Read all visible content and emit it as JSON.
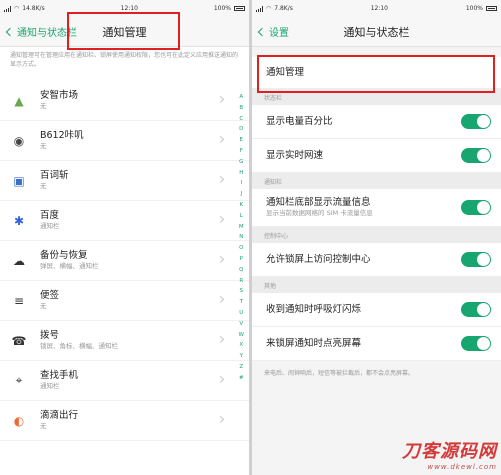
{
  "left": {
    "status": {
      "carrier": "14.8K/s",
      "time": "12:10",
      "battery": "100%"
    },
    "back_label": "通知与状态栏",
    "title": "通知管理",
    "description": "通知管理可在管理应用在通知栏、锁屏使用通知权限，您也可在此定义应用推送通知的显示方式。",
    "apps": [
      {
        "name": "安智市场",
        "sub": "无",
        "icon": "android-market-icon",
        "color": "#6aa84f"
      },
      {
        "name": "B612咔叽",
        "sub": "无",
        "icon": "camera-app-icon",
        "color": "#444444"
      },
      {
        "name": "百词斩",
        "sub": "无",
        "icon": "word-app-icon",
        "color": "#3b6ec5"
      },
      {
        "name": "百度",
        "sub": "通知栏",
        "icon": "baidu-paw-icon",
        "color": "#2f63d9"
      },
      {
        "name": "备份与恢复",
        "sub": "弹屏、横幅、通知栏",
        "icon": "backup-cloud-icon",
        "color": "#333333"
      },
      {
        "name": "便签",
        "sub": "无",
        "icon": "notes-icon",
        "color": "#333333"
      },
      {
        "name": "拨号",
        "sub": "锁屏、角标、横幅、通知栏",
        "icon": "phone-icon",
        "color": "#333333"
      },
      {
        "name": "查找手机",
        "sub": "通知栏",
        "icon": "find-phone-icon",
        "color": "#333333"
      },
      {
        "name": "滴滴出行",
        "sub": "无",
        "icon": "didi-icon",
        "color": "#f06a35"
      }
    ],
    "index_letters": [
      "A",
      "B",
      "C",
      "D",
      "E",
      "F",
      "G",
      "H",
      "I",
      "J",
      "K",
      "L",
      "M",
      "N",
      "O",
      "P",
      "Q",
      "R",
      "S",
      "T",
      "U",
      "V",
      "W",
      "X",
      "Y",
      "Z",
      "#"
    ]
  },
  "right": {
    "status": {
      "carrier": "7.8K/s",
      "time": "12:10",
      "battery": "100%"
    },
    "back_label": "设置",
    "title": "通知与状态栏",
    "notif_manage": "通知管理",
    "sections": [
      {
        "header": "状态栏",
        "rows": [
          {
            "label": "显示电量百分比",
            "sub": "",
            "on": true
          },
          {
            "label": "显示实时网速",
            "sub": "",
            "on": true
          }
        ]
      },
      {
        "header": "通知栏",
        "rows": [
          {
            "label": "通知栏底部显示流量信息",
            "sub": "显示当前数据网络的 SIM 卡流量信息",
            "on": true
          }
        ]
      },
      {
        "header": "控制中心",
        "rows": [
          {
            "label": "允许锁屏上访问控制中心",
            "sub": "",
            "on": true
          }
        ]
      },
      {
        "header": "其他",
        "rows": [
          {
            "label": "收到通知时呼吸灯闪烁",
            "sub": "",
            "on": true
          },
          {
            "label": "来锁屏通知时点亮屏幕",
            "sub": "",
            "on": true
          }
        ]
      }
    ],
    "footer": "来电后、闹钟响后，短信等被拦截后，都不会点亮屏幕。"
  },
  "watermark": {
    "main": "刀客源码网",
    "url": "www.dkewl.com"
  },
  "colors": {
    "accent": "#19a56f",
    "highlight": "#e21f1f"
  }
}
